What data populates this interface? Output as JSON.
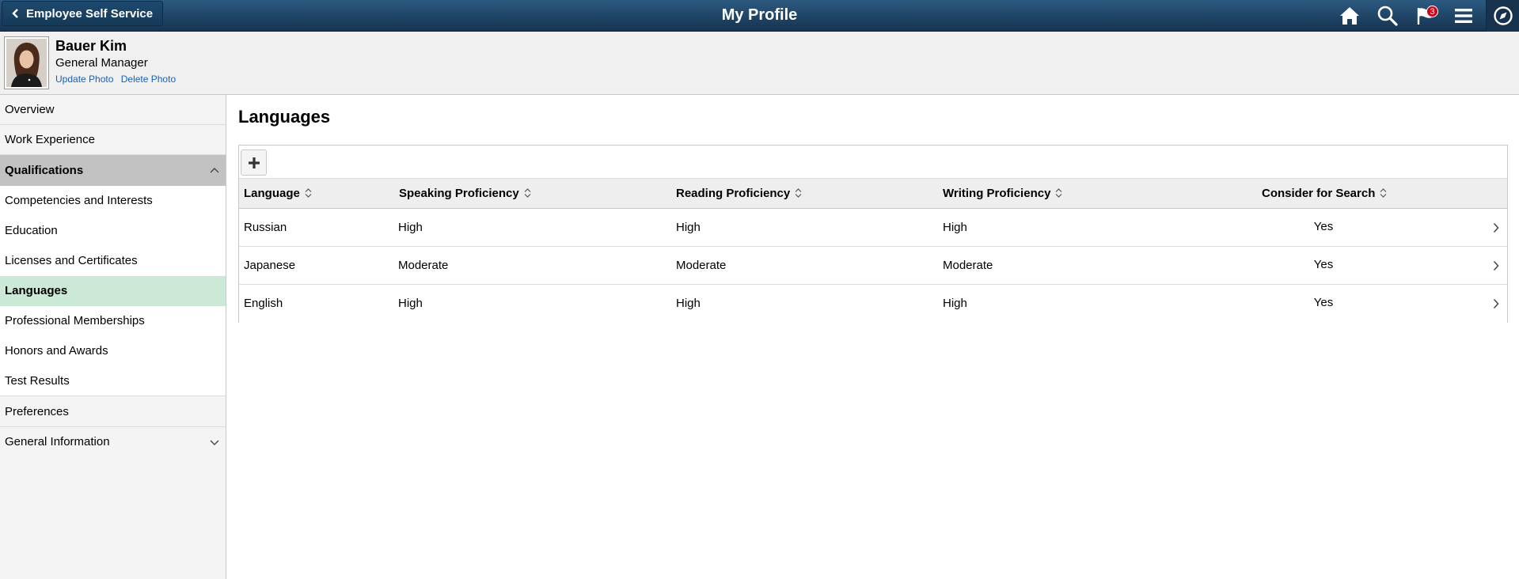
{
  "header": {
    "back_label": "Employee Self Service",
    "title": "My Profile",
    "notification_count": "3",
    "icons": [
      "home-icon",
      "search-icon",
      "notification-flag-icon",
      "menu-icon",
      "navbar-compass-icon"
    ],
    "colors": {
      "banner": "#1f4466",
      "badge": "#d0021b"
    }
  },
  "employee": {
    "name": "Bauer Kim",
    "job_title": "General Manager",
    "update_photo": "Update Photo",
    "delete_photo": "Delete Photo"
  },
  "sidebar": {
    "items": [
      {
        "label": "Overview"
      },
      {
        "label": "Work Experience"
      }
    ],
    "group": {
      "label": "Qualifications",
      "expanded": true,
      "items": [
        {
          "label": "Competencies and Interests",
          "selected": false
        },
        {
          "label": "Education",
          "selected": false
        },
        {
          "label": "Licenses and Certificates",
          "selected": false
        },
        {
          "label": "Languages",
          "selected": true
        },
        {
          "label": "Professional Memberships",
          "selected": false
        },
        {
          "label": "Honors and Awards",
          "selected": false
        },
        {
          "label": "Test Results",
          "selected": false
        }
      ]
    },
    "after_items": [
      {
        "label": "Preferences"
      },
      {
        "label": "General Information"
      }
    ],
    "colors": {
      "group_bg": "#c2c2c2",
      "selected_bg": "#cce8d6"
    }
  },
  "main": {
    "title": "Languages",
    "columns": [
      "Language",
      "Speaking Proficiency",
      "Reading Proficiency",
      "Writing Proficiency",
      "Consider for Search"
    ],
    "rows": [
      {
        "language": "Russian",
        "speaking": "High",
        "reading": "High",
        "writing": "High",
        "search": "Yes"
      },
      {
        "language": "Japanese",
        "speaking": "Moderate",
        "reading": "Moderate",
        "writing": "Moderate",
        "search": "Yes"
      },
      {
        "language": "English",
        "speaking": "High",
        "reading": "High",
        "writing": "High",
        "search": "Yes"
      }
    ]
  }
}
